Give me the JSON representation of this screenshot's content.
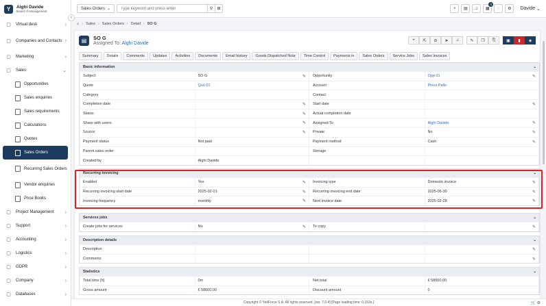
{
  "brand": {
    "initial": "Y",
    "name": "Alghi Davide",
    "role": "Board of Management"
  },
  "sidebar": [
    {
      "label": "Virtual desk",
      "icon": "desk-icon",
      "chev": "›"
    },
    {
      "label": "Companies and Contacts",
      "icon": "building-icon",
      "chev": "›",
      "tall": true
    },
    {
      "label": "Marketing",
      "icon": "megaphone-icon",
      "chev": "›"
    },
    {
      "label": "Sales",
      "icon": "folder-icon",
      "chev": "⌄"
    }
  ],
  "sales_sub": [
    {
      "label": "Opportunities"
    },
    {
      "label": "Sales enquiries"
    },
    {
      "label": "Sales requirements"
    },
    {
      "label": "Calculations"
    },
    {
      "label": "Quotes"
    },
    {
      "label": "Sales Orders",
      "active": true
    },
    {
      "label": "Recurring Sales Orders",
      "tall": true
    },
    {
      "label": "Vendor enquiries"
    },
    {
      "label": "Price Books"
    }
  ],
  "sidebar_bottom": [
    {
      "label": "Project Management",
      "icon": "briefcase-icon",
      "chev": "›"
    },
    {
      "label": "Support",
      "icon": "support-icon",
      "chev": "›"
    },
    {
      "label": "Accounting",
      "icon": "accounting-icon",
      "chev": "›"
    },
    {
      "label": "Logistics",
      "icon": "truck-icon",
      "chev": "›"
    },
    {
      "label": "GDPR",
      "icon": "lock-icon",
      "chev": "›"
    },
    {
      "label": "Company",
      "icon": "company-icon",
      "chev": "›"
    },
    {
      "label": "Databases",
      "icon": "database-icon",
      "chev": "›"
    }
  ],
  "topbar": {
    "module": "Sales Orders",
    "search_placeholder": "Type keyword and press enter",
    "badge": "2",
    "user": "Davide"
  },
  "breadcrumb": {
    "items": [
      "Sales",
      "Sales Orders",
      "Detail"
    ],
    "current": "SO G"
  },
  "record": {
    "title": "SO G",
    "assigned_prefix": "Assigned To:",
    "assigned_to": "Alghi Davide"
  },
  "tabs": [
    "Summary",
    "Details",
    "Comments",
    "Updates",
    "Activities",
    "Documents",
    "Email history",
    "Goods Dispatched Note",
    "Time Control",
    "Payments in",
    "Sales Orders",
    "Service Jobs",
    "Sales Invoices"
  ],
  "active_tab": "Details",
  "basic": {
    "title": "Basic information",
    "rows": [
      [
        "Subject",
        "SO G",
        true,
        "",
        "Opportunity",
        "Opp 01",
        true,
        "link"
      ],
      [
        "Quote",
        "Quo 01",
        false,
        "link",
        "Account",
        "Pinco Pallo",
        false,
        "link"
      ],
      [
        "Category",
        "",
        false,
        "",
        "Contact",
        "",
        false,
        ""
      ],
      [
        "Completion date",
        "",
        true,
        "",
        "Start date",
        "",
        true,
        ""
      ],
      [
        "Status",
        "",
        true,
        "",
        "Actual completion date",
        "",
        false,
        ""
      ],
      [
        "Share with users:",
        "",
        true,
        "",
        "Assigned To",
        "Alghi Davide",
        true,
        "link"
      ],
      [
        "Source",
        "",
        true,
        "",
        "Private",
        "No",
        true,
        ""
      ],
      [
        "Payment status",
        "Not paid",
        false,
        "",
        "Payment method",
        "Cash",
        true,
        ""
      ],
      [
        "Parent sales order",
        "",
        false,
        "",
        "Storage",
        "",
        false,
        ""
      ],
      [
        "Created by",
        "Alghi Davide",
        false,
        "",
        "",
        "",
        false,
        ""
      ]
    ]
  },
  "recurring": {
    "title": "Recurring invoicing",
    "rows": [
      [
        "Enabled",
        "Yes",
        true,
        "",
        "Invoicing type",
        "Domestic invoice",
        true,
        ""
      ],
      [
        "Recurring invoicing start date",
        "2025-02-01",
        true,
        "",
        "Recurring invoicing end date",
        "2025-06-30",
        true,
        ""
      ],
      [
        "Invoicing frequency",
        "monthly",
        true,
        "",
        "Next invoice date",
        "2025-02-28",
        true,
        ""
      ]
    ]
  },
  "services": {
    "title": "Services jobs",
    "rows": [
      [
        "Create jobs for services",
        "No",
        true,
        "",
        "To copy",
        "",
        true,
        ""
      ]
    ]
  },
  "description": {
    "title": "Description details",
    "rows": [
      [
        "Description",
        "",
        false,
        "",
        "",
        "",
        true,
        ""
      ],
      [
        "Comments",
        "",
        false,
        "",
        "",
        "",
        true,
        ""
      ]
    ]
  },
  "statistics": {
    "title": "Statistics",
    "rows": [
      [
        "Total time [h]",
        "0m",
        false,
        "",
        "Net total",
        "€ 58600,00",
        false,
        ""
      ],
      [
        "Gross amount",
        "€ 58600,00",
        false,
        "",
        "Discount amount",
        "0",
        false,
        ""
      ]
    ]
  },
  "footer": "Copyright © YetiForce S.A. All rights reserved. [ver. 7.0.4] [Page loading time: 0.153s.]"
}
